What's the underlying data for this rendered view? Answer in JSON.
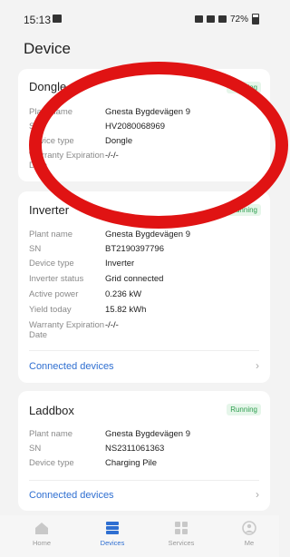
{
  "status_bar": {
    "time": "15:13",
    "battery": "72%"
  },
  "page": {
    "title": "Device"
  },
  "dongle_card": {
    "title": "Dongle",
    "status": "Running",
    "rows": [
      {
        "label": "Plant name",
        "value": "Gnesta Bygdevägen 9"
      },
      {
        "label": "SN",
        "value": "HV2080068969"
      },
      {
        "label": "Device type",
        "value": "Dongle"
      },
      {
        "label": "Warranty Expiration Date",
        "value": "-/-/-"
      }
    ]
  },
  "inverter_card": {
    "title": "Inverter",
    "status": "Running",
    "rows": [
      {
        "label": "Plant name",
        "value": "Gnesta Bygdevägen 9"
      },
      {
        "label": "SN",
        "value": "BT2190397796"
      },
      {
        "label": "Device type",
        "value": "Inverter"
      },
      {
        "label": "Inverter status",
        "value": "Grid connected"
      },
      {
        "label": "Active power",
        "value": "0.236 kW"
      },
      {
        "label": "Yield today",
        "value": "15.82 kWh"
      },
      {
        "label": "Warranty Expiration Date",
        "value": "-/-/-"
      }
    ],
    "link": "Connected devices"
  },
  "laddbox_card": {
    "title": "Laddbox",
    "status": "Running",
    "rows": [
      {
        "label": "Plant name",
        "value": "Gnesta Bygdevägen 9"
      },
      {
        "label": "SN",
        "value": "NS2311061363"
      },
      {
        "label": "Device type",
        "value": "Charging Pile"
      }
    ],
    "link": "Connected devices"
  },
  "tabbar": {
    "tabs": [
      {
        "label": "Home",
        "icon": "home-icon"
      },
      {
        "label": "Devices",
        "icon": "devices-icon",
        "active": true
      },
      {
        "label": "Services",
        "icon": "services-icon"
      },
      {
        "label": "Me",
        "icon": "user-icon"
      }
    ]
  },
  "colors": {
    "accent": "#2f6fd1",
    "running": "#2e9e4f",
    "annotation": "#e01313"
  }
}
